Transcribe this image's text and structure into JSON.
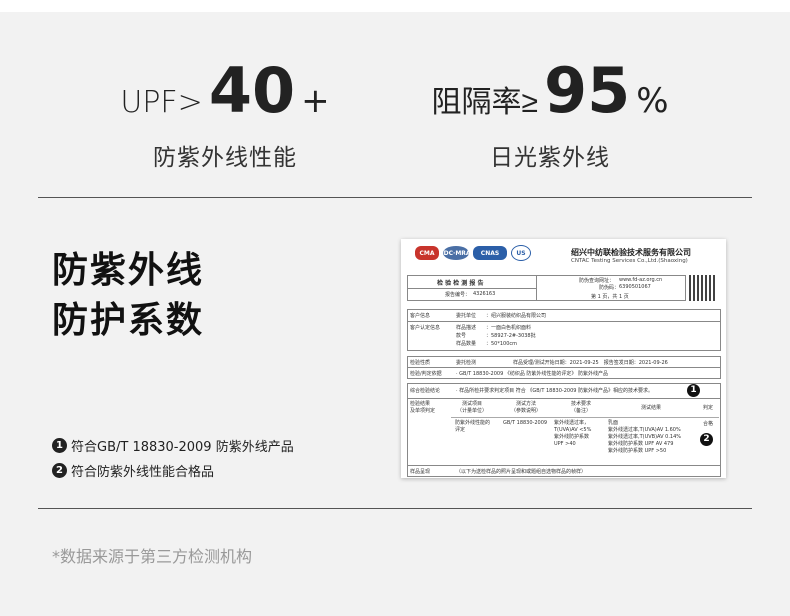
{
  "stats": [
    {
      "prefix": "UPF>",
      "value": "40",
      "suffix": "+",
      "caption": "防紫外线性能"
    },
    {
      "prefix": "阻隔率≥",
      "value": "95",
      "suffix": "%",
      "caption": "日光紫外线"
    }
  ],
  "section": {
    "title_line1": "防紫外线",
    "title_line2": "防护系数"
  },
  "bullets": [
    {
      "num": "1",
      "text": "符合GB/T 18830-2009 防紫外线产品"
    },
    {
      "num": "2",
      "text": "符合防紫外线性能合格品"
    }
  ],
  "footnote": "*数据来源于第三方检测机构",
  "certificate": {
    "logos": [
      "CMA",
      "IDC·MRA",
      "CNAS",
      "US"
    ],
    "org_cn": "绍兴中纺联检验技术服务有限公司",
    "org_en": "CNTAC Testing Services Co.,Ltd.(Shaoxing)",
    "report_title": "检 验 检 测 报 告",
    "report_no_label": "报告编号：",
    "report_no": "4326163",
    "website_label": "防伪查询网址：",
    "website": "www.fd-az.org.cn",
    "code_label": "防伪码：",
    "code": "6390501067",
    "page": "第 1 页，共 1 页",
    "client_label": "客户信息",
    "client_k": "委托单位",
    "client_v": "：绍兴服装纺织品有限公司",
    "sample_label": "客户认定信息",
    "sample_rows": [
      {
        "k": "样品描述",
        "v": "：一面白色机织面料"
      },
      {
        "k": "款号",
        "v": "：58927-2#-3038批"
      },
      {
        "k": "样品数量",
        "v": "：50*100cm"
      }
    ],
    "test_label": "检验性质",
    "test_k": "委托检测",
    "test_dates": "样品受理/测试开始日期：2021-09-25　报告签发日期：2021-09-26",
    "basis_label": "检验/判定依据",
    "basis_v": "· GB/T 18830-2009 《纺织品 防紫外线性能的评定》 防紫外线产品",
    "conclusion_label": "综合检验结论",
    "conclusion_v": "· 样品所检并要求判定项目 符合 《GB/T 18830-2009 防紫外线产品》相应的技术要求。",
    "table_label": "检验结果\n及单项判定",
    "headers": [
      "测试项目\n（计量单位）",
      "测试方法\n（参数说明）",
      "技术要求\n（备注）",
      "测试结果",
      "判定"
    ],
    "row": {
      "item": "防紫外线性能的\n评定",
      "method": "GB/T 18830-2009",
      "req": "紫外线透过率，\nT(UVA)AV <5%\n紫外线防护系数\nUPF >40",
      "result": "乳面\n紫外线透过率,T(UVA)AV 1.60%\n紫外线透过率,T(UVB)AV 0.14%\n紫外线防护系数 UPF AV 479\n紫外线防护系数 UPF >50",
      "verdict": "合格"
    },
    "remark_label": "样品呈现",
    "remark_v": "（以下为送检样品的照片呈现和或题组自选物样品的帧样）",
    "marks": [
      "1",
      "2"
    ]
  }
}
